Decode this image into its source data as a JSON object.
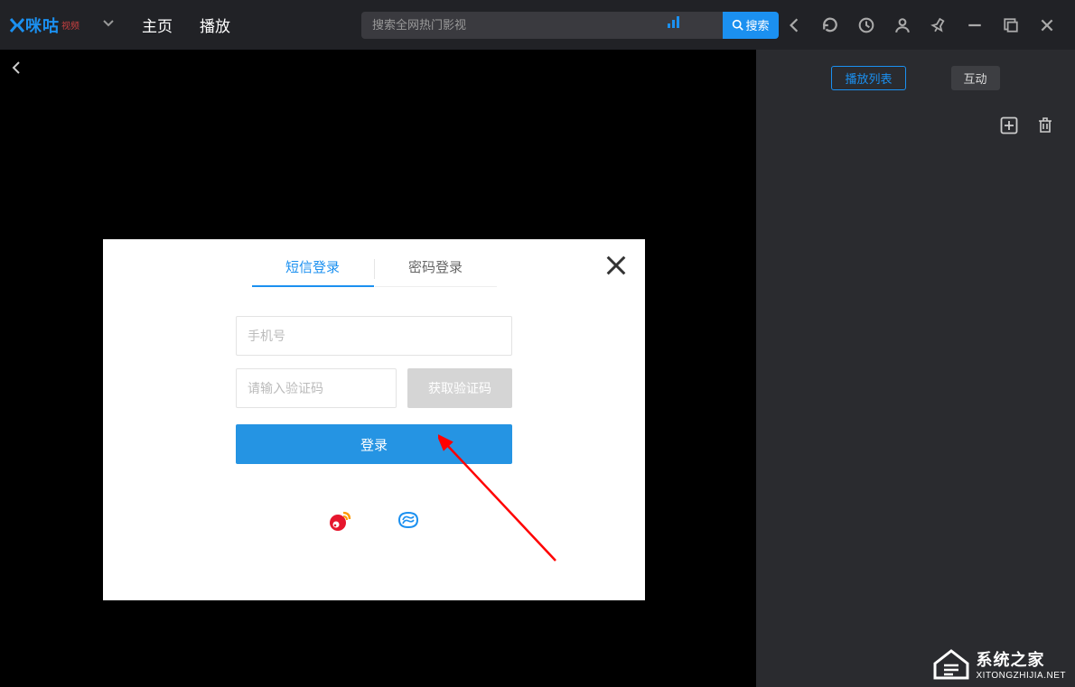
{
  "header": {
    "logo_main": "咪咕",
    "logo_sub": "视频",
    "nav": {
      "home": "主页",
      "play": "播放"
    },
    "search": {
      "placeholder": "搜索全网热门影视",
      "button": "搜索"
    }
  },
  "sidebar": {
    "tabs": {
      "playlist": "播放列表",
      "interact": "互动"
    }
  },
  "modal": {
    "tabs": {
      "sms": "短信登录",
      "password": "密码登录"
    },
    "phone_placeholder": "手机号",
    "code_placeholder": "请输入验证码",
    "send_code_label": "获取验证码",
    "login_label": "登录"
  },
  "watermark": {
    "title": "系统之家",
    "sub": "XITONGZHIJIA.NET"
  }
}
